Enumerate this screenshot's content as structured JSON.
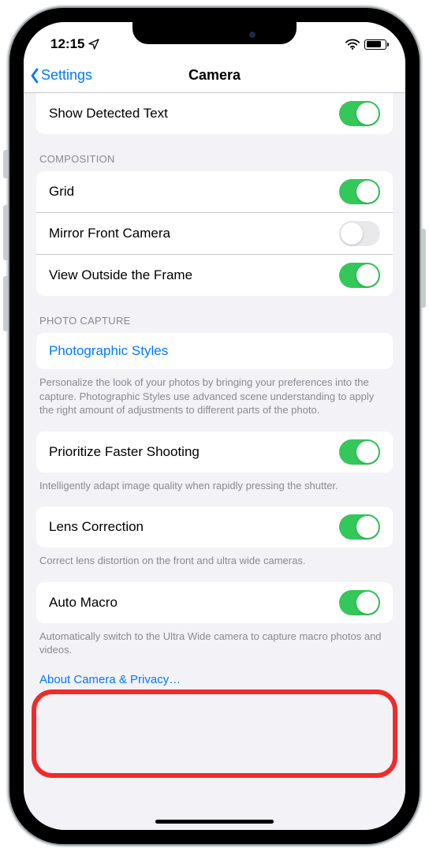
{
  "status": {
    "time": "12:15"
  },
  "nav": {
    "back": "Settings",
    "title": "Camera"
  },
  "top_row": {
    "label": "Show Detected Text",
    "on": true
  },
  "composition": {
    "header": "COMPOSITION",
    "items": [
      {
        "label": "Grid",
        "on": true
      },
      {
        "label": "Mirror Front Camera",
        "on": false
      },
      {
        "label": "View Outside the Frame",
        "on": true
      }
    ]
  },
  "photo_capture": {
    "header": "PHOTO CAPTURE",
    "styles_label": "Photographic Styles",
    "styles_footer": "Personalize the look of your photos by bringing your preferences into the capture. Photographic Styles use advanced scene understanding to apply the right amount of adjustments to different parts of the photo.",
    "prioritize": {
      "label": "Prioritize Faster Shooting",
      "on": true
    },
    "prioritize_footer": "Intelligently adapt image quality when rapidly pressing the shutter.",
    "lens": {
      "label": "Lens Correction",
      "on": true
    },
    "lens_footer": "Correct lens distortion on the front and ultra wide cameras.",
    "macro": {
      "label": "Auto Macro",
      "on": true
    },
    "macro_footer": "Automatically switch to the Ultra Wide camera to capture macro photos and videos.",
    "about_link": "About Camera & Privacy…"
  }
}
